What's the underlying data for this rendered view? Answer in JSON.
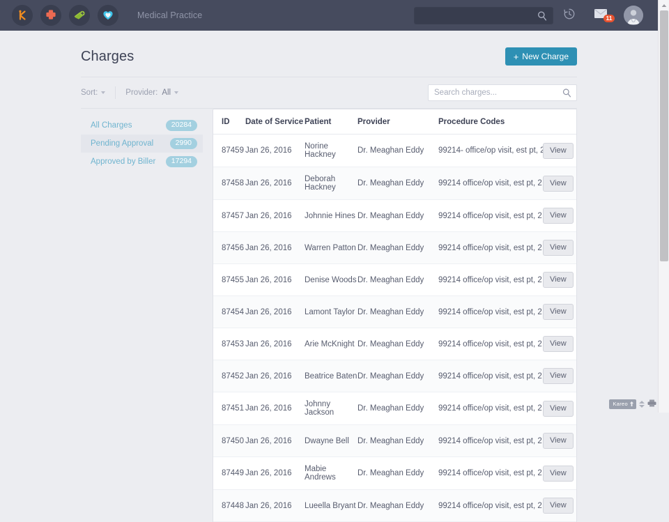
{
  "topbar": {
    "app_icons": [
      {
        "name": "kareo-logo-icon",
        "label": "Kareo"
      },
      {
        "name": "medical-cross-icon",
        "label": "Clinical"
      },
      {
        "name": "billing-money-icon",
        "label": "Billing"
      },
      {
        "name": "patient-heart-icon",
        "label": "Patients"
      }
    ],
    "practice_name": "Medical Practice",
    "search_value": "",
    "search_placeholder": "",
    "history_icon": "history-clock-icon",
    "messages_icon": "envelope-icon",
    "messages_count": "11",
    "avatar": "user-avatar"
  },
  "header": {
    "title": "Charges",
    "new_charge_label": "New Charge",
    "new_charge_plus": "+",
    "accent_color": "#2e90b4"
  },
  "filterbar": {
    "sort_label": "Sort:",
    "sort_value": "",
    "provider_label": "Provider:",
    "provider_value": "All",
    "search_value": "",
    "search_placeholder": "Search charges..."
  },
  "sidelist": {
    "items": [
      {
        "label": "All Charges",
        "count": "20284",
        "active": false
      },
      {
        "label": "Pending Approval",
        "count": "2990",
        "active": true
      },
      {
        "label": "Approved by Biller",
        "count": "17294",
        "active": false
      }
    ]
  },
  "table": {
    "columns": [
      "ID",
      "Date of Service",
      "Patient",
      "Provider",
      "Procedure Codes",
      ""
    ],
    "action_label": "View",
    "rows": [
      {
        "id": "87459",
        "dos": "Jan 26, 2016",
        "patient": "Norine Hackney",
        "provider": "Dr. Meaghan Eddy",
        "procedure": "99214- office/op visit, est pt, 2..."
      },
      {
        "id": "87458",
        "dos": "Jan 26, 2016",
        "patient": "Deborah Hackney",
        "provider": "Dr. Meaghan Eddy",
        "procedure": "99214 office/op visit, est pt, 2 ..."
      },
      {
        "id": "87457",
        "dos": "Jan 26, 2016",
        "patient": "Johnnie Hines",
        "provider": "Dr. Meaghan Eddy",
        "procedure": "99214 office/op visit, est pt, 2 ..."
      },
      {
        "id": "87456",
        "dos": "Jan 26, 2016",
        "patient": "Warren Patton",
        "provider": "Dr. Meaghan Eddy",
        "procedure": "99214 office/op visit, est pt, 2 ..."
      },
      {
        "id": "87455",
        "dos": "Jan 26, 2016",
        "patient": "Denise Woods",
        "provider": "Dr. Meaghan Eddy",
        "procedure": "99214 office/op visit, est pt, 2 ..."
      },
      {
        "id": "87454",
        "dos": "Jan 26, 2016",
        "patient": "Lamont Taylor",
        "provider": "Dr. Meaghan Eddy",
        "procedure": "99214 office/op visit, est pt, 2 ..."
      },
      {
        "id": "87453",
        "dos": "Jan 26, 2016",
        "patient": "Arie McKnight",
        "provider": "Dr. Meaghan Eddy",
        "procedure": "99214 office/op visit, est pt, 2 ..."
      },
      {
        "id": "87452",
        "dos": "Jan 26, 2016",
        "patient": "Beatrice Baten",
        "provider": "Dr. Meaghan Eddy",
        "procedure": "99214 office/op visit, est pt, 2 ..."
      },
      {
        "id": "87451",
        "dos": "Jan 26, 2016",
        "patient": "Johnny Jackson",
        "provider": "Dr. Meaghan Eddy",
        "procedure": "99214 office/op visit, est pt, 2 ..."
      },
      {
        "id": "87450",
        "dos": "Jan 26, 2016",
        "patient": "Dwayne Bell",
        "provider": "Dr. Meaghan Eddy",
        "procedure": "99214 office/op visit, est pt, 2 ..."
      },
      {
        "id": "87449",
        "dos": "Jan 26, 2016",
        "patient": "Mabie Andrews",
        "provider": "Dr. Meaghan Eddy",
        "procedure": "99214 office/op visit, est pt, 2 ..."
      },
      {
        "id": "87448",
        "dos": "Jan 26, 2016",
        "patient": "Lueella Bryant",
        "provider": "Dr. Meaghan Eddy",
        "procedure": "99214 office/op visit, est pt, 2 ..."
      }
    ]
  },
  "widget": {
    "brand": "Kareo"
  }
}
